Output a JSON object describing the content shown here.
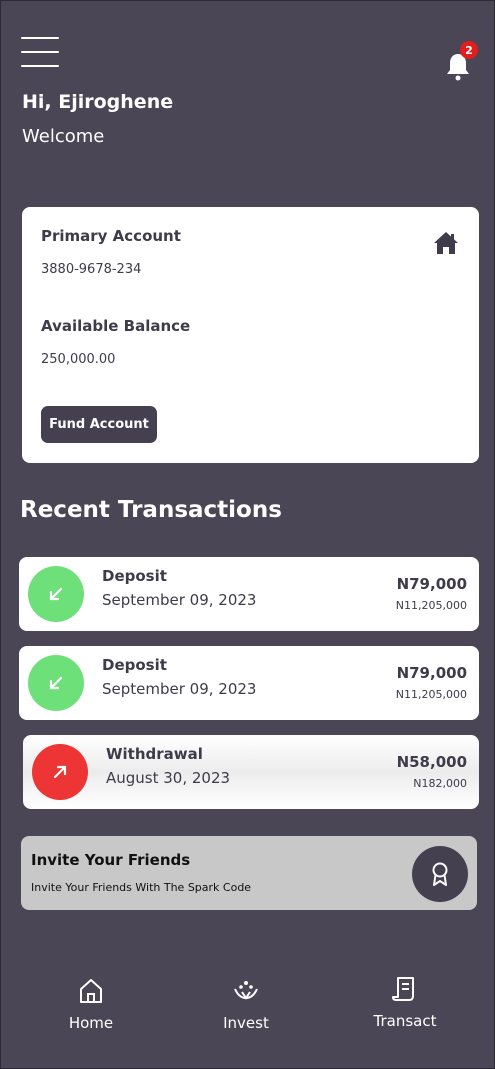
{
  "header": {
    "greeting": "Hi, Ejiroghene",
    "welcome": "Welcome",
    "notification_count": "2"
  },
  "account": {
    "primary_label": "Primary Account",
    "account_number": "3880-9678-234",
    "balance_label": "Available Balance",
    "balance_value": "250,000.00",
    "fund_button": "Fund Account"
  },
  "transactions": {
    "title": "Recent Transactions",
    "items": [
      {
        "type": "Deposit",
        "date": "September 09, 2023",
        "amount": "N79,000",
        "balance": "N11,205,000",
        "color": "#6ee07a"
      },
      {
        "type": "Deposit",
        "date": "September 09, 2023",
        "amount": "N79,000",
        "balance": "N11,205,000",
        "color": "#6ee07a"
      },
      {
        "type": "Withdrawal",
        "date": "August 30, 2023",
        "amount": "N58,000",
        "balance": "N182,000",
        "color": "#ee3535"
      }
    ]
  },
  "invite": {
    "title": "Invite Your Friends",
    "subtitle": "Invite Your Friends With The Spark Code"
  },
  "nav": {
    "home": "Home",
    "invest": "Invest",
    "transact": "Transact"
  },
  "colors": {
    "background": "#4a4656",
    "button": "#44404f",
    "deposit": "#6ee07a",
    "withdrawal": "#ee3535"
  }
}
